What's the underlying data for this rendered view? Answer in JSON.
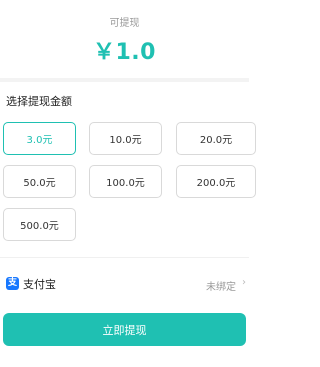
{
  "balance": {
    "label": "可提现",
    "amount": "￥1.0"
  },
  "section_title": "选择提现金额",
  "amounts": {
    "opt0": "3.0元",
    "opt1": "10.0元",
    "opt2": "20.0元",
    "opt3": "50.0元",
    "opt4": "100.0元",
    "opt5": "200.0元",
    "opt6": "500.0元",
    "selected": "3.0元"
  },
  "payment": {
    "icon": "支",
    "icon_name": "alipay-icon",
    "label": "支付宝",
    "status": "未绑定",
    "chevron": "›"
  },
  "withdraw_button": "立即提现",
  "colors": {
    "accent": "#1fc0b2",
    "alipay": "#1677ff"
  }
}
